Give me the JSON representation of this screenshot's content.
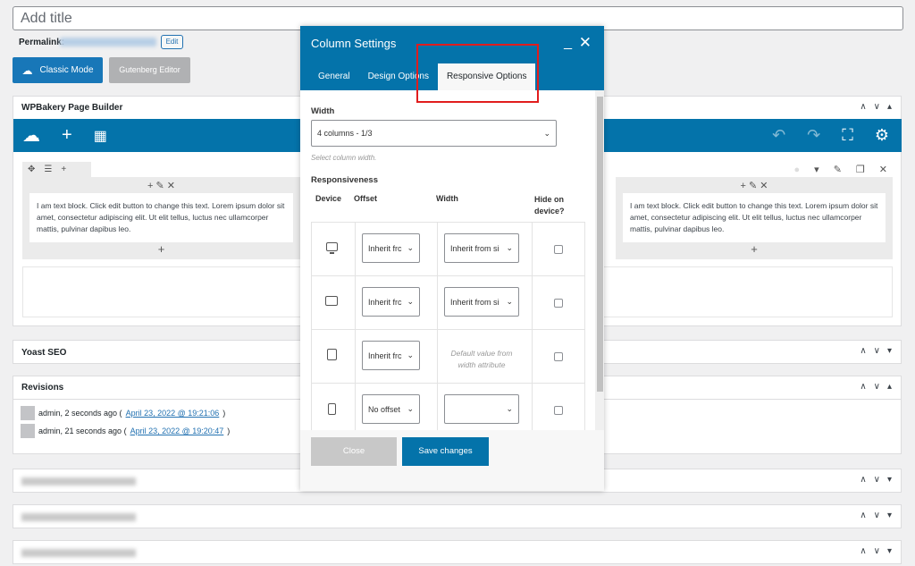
{
  "post": {
    "title_placeholder": "Add title",
    "permalink_label": "Permalink:",
    "edit_label": "Edit"
  },
  "mode": {
    "classic": "Classic Mode",
    "gutenberg": "Gutenberg Editor"
  },
  "wpbakery": {
    "title": "WPBakery Page Builder"
  },
  "text_block": "I am text block. Click edit button to change this text. Lorem ipsum dolor sit amet, consectetur adipiscing elit. Ut elit tellus, luctus nec ullamcorper mattis, pulvinar dapibus leo.",
  "yoast": {
    "title": "Yoast SEO"
  },
  "revisions": {
    "title": "Revisions",
    "items": [
      {
        "text": "admin, 2 seconds ago (",
        "link": "April 23, 2022 @ 19:21:06",
        "end": ")"
      },
      {
        "text": "admin, 21 seconds ago (",
        "link": "April 23, 2022 @ 19:20:47",
        "end": ")"
      }
    ]
  },
  "modal": {
    "title": "Column Settings",
    "tabs": [
      "General",
      "Design Options",
      "Responsive Options"
    ],
    "width_label": "Width",
    "width_value": "4 columns - 1/3",
    "width_hint": "Select column width.",
    "responsiveness_label": "Responsiveness",
    "headers": {
      "device": "Device",
      "offset": "Offset",
      "width": "Width",
      "hide": "Hide on device?"
    },
    "rows": [
      {
        "device": "desktop-icon",
        "offset": "Inherit frc",
        "width": "Inherit from si"
      },
      {
        "device": "tablet-landscape-icon",
        "offset": "Inherit frc",
        "width": "Inherit from si"
      },
      {
        "device": "tablet-portrait-icon",
        "offset": "Inherit frc",
        "width": "Default value from width attribute"
      },
      {
        "device": "mobile-icon",
        "offset": "No offset",
        "width": ""
      }
    ],
    "close_label": "Close",
    "save_label": "Save changes"
  },
  "colors": {
    "accent": "#0473aa",
    "highlight": "#e11d1d"
  }
}
